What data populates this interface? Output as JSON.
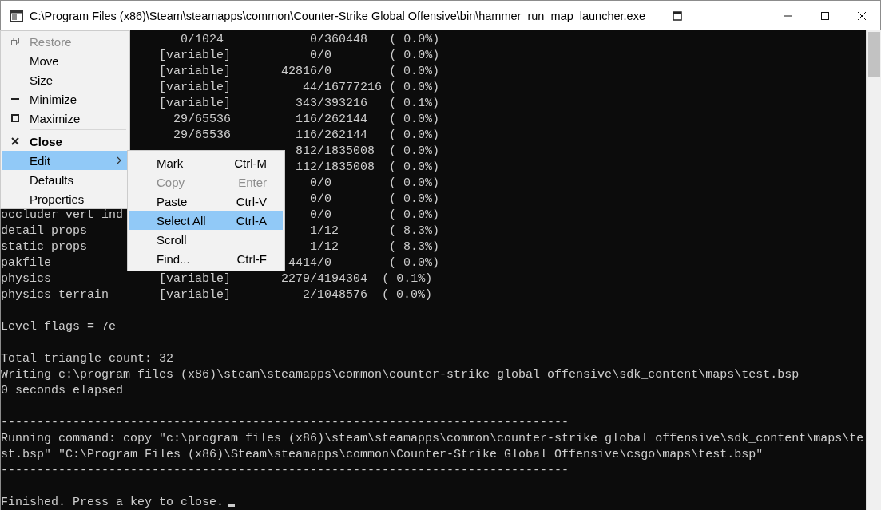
{
  "window": {
    "title": "C:\\Program Files (x86)\\Steam\\steamapps\\common\\Counter-Strike Global Offensive\\bin\\hammer_run_map_launcher.exe"
  },
  "console": {
    "blocks": [
      [
        "                         0/1024            0/360448   ( 0.0%)",
        "                      [variable]           0/0        ( 0.0%)",
        "                      [variable]       42816/0        ( 0.0%)",
        "                      [variable]          44/16777216 ( 0.0%)",
        "                      [variable]         343/393216   ( 0.1%)",
        "                        29/65536         116/262144   ( 0.0%)",
        "                        29/65536         116/262144   ( 0.0%)",
        "                                         812/1835008  ( 0.0%)",
        "                                         112/1835008  ( 0.0%)",
        "                                           0/0        ( 0.0%)",
        "                                           0/0        ( 0.0%)",
        "occluder vert ind                          0/0        ( 0.0%)",
        "detail props                               1/12       ( 8.3%)",
        "static props                               1/12       ( 8.3%)",
        "pakfile                                 4414/0        ( 0.0%)",
        "physics               [variable]       2279/4194304  ( 0.1%)",
        "physics terrain       [variable]          2/1048576  ( 0.0%)"
      ],
      [
        "Level flags = 7e"
      ],
      [
        "Total triangle count: 32",
        "Writing c:\\program files (x86)\\steam\\steamapps\\common\\counter-strike global offensive\\sdk_content\\maps\\test.bsp",
        "0 seconds elapsed"
      ],
      [
        "-------------------------------------------------------------------------------",
        "Running command: copy \"c:\\program files (x86)\\steam\\steamapps\\common\\counter-strike global offensive\\sdk_content\\maps\\te",
        "st.bsp\" \"C:\\Program Files (x86)\\Steam\\steamapps\\common\\Counter-Strike Global Offensive\\csgo\\maps\\test.bsp\"",
        "-------------------------------------------------------------------------------"
      ],
      [
        "Finished. Press a key to close."
      ]
    ],
    "cursor": true
  },
  "system_menu": {
    "groups": [
      [
        {
          "label": "Restore",
          "disabled": true,
          "selected": false,
          "bold": false,
          "submenu": false
        },
        {
          "label": "Move",
          "disabled": false,
          "selected": false,
          "bold": false,
          "submenu": false
        },
        {
          "label": "Size",
          "disabled": false,
          "selected": false,
          "bold": false,
          "submenu": false
        },
        {
          "label": "Minimize",
          "disabled": false,
          "selected": false,
          "bold": false,
          "submenu": false
        },
        {
          "label": "Maximize",
          "disabled": false,
          "selected": false,
          "bold": false,
          "submenu": false
        }
      ],
      [
        {
          "label": "Close",
          "disabled": false,
          "selected": false,
          "bold": true,
          "submenu": false
        },
        {
          "label": "Edit",
          "disabled": false,
          "selected": true,
          "bold": false,
          "submenu": true
        },
        {
          "label": "Defaults",
          "disabled": false,
          "selected": false,
          "bold": false,
          "submenu": false
        },
        {
          "label": "Properties",
          "disabled": false,
          "selected": false,
          "bold": false,
          "submenu": false
        }
      ]
    ]
  },
  "edit_submenu": {
    "items": [
      {
        "label": "Mark",
        "shortcut": "Ctrl-M",
        "disabled": false,
        "selected": false
      },
      {
        "label": "Copy",
        "shortcut": "Enter",
        "disabled": true,
        "selected": false
      },
      {
        "label": "Paste",
        "shortcut": "Ctrl-V",
        "disabled": false,
        "selected": false
      },
      {
        "label": "Select All",
        "shortcut": "Ctrl-A",
        "disabled": false,
        "selected": true
      },
      {
        "label": "Scroll",
        "disabled": false,
        "selected": false
      },
      {
        "label": "Find...",
        "shortcut": "Ctrl-F",
        "disabled": false,
        "selected": false
      }
    ]
  }
}
